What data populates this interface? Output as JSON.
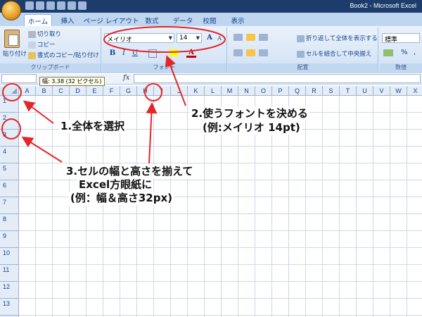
{
  "window": {
    "title": "Book2 - Microsoft Excel"
  },
  "quick_access": {
    "icons": [
      "save-icon",
      "undo-icon",
      "redo-icon",
      "cursor-icon",
      "format-icon",
      "customize-icon"
    ]
  },
  "tabs": [
    "ホーム",
    "挿入",
    "ページ レイアウト",
    "数式",
    "データ",
    "校閲",
    "表示"
  ],
  "ribbon": {
    "clipboard": {
      "paste": "貼り付け",
      "cut": "切り取り",
      "copy": "コピー",
      "format_painter": "書式のコピー/貼り付け",
      "label": "クリップボード"
    },
    "font": {
      "name": "メイリオ",
      "size": "14",
      "label": "フォント",
      "bold": "B",
      "italic": "I",
      "underline": "U",
      "color": "A"
    },
    "alignment": {
      "wrap": "折り返して全体を表示する",
      "merge": "セルを結合して中央揃え",
      "label": "配置"
    },
    "number": {
      "format": "標準",
      "percent": "%",
      "comma": ",",
      "label": "数値"
    }
  },
  "formula_bar": {
    "fx": "fx",
    "tooltip": "幅: 3.38 (32 ピクセル)"
  },
  "grid": {
    "columns": [
      "A",
      "B",
      "C",
      "D",
      "E",
      "F",
      "G",
      "H",
      "I",
      "J",
      "K",
      "L",
      "M",
      "N",
      "O",
      "P",
      "Q",
      "R",
      "S",
      "T",
      "U",
      "V",
      "W",
      "X"
    ],
    "rows": [
      "1",
      "2",
      "3",
      "4",
      "5",
      "6",
      "7",
      "8",
      "9",
      "10",
      "11",
      "12",
      "13"
    ]
  },
  "annotations": {
    "step1": "1.全体を選択",
    "step2_line1": "2.使うフォントを決める",
    "step2_line2": "(例:メイリオ 14pt)",
    "step3_line1": "3.セルの幅と高さを揃えて",
    "step3_line2": "Excel方眼紙に",
    "step3_line3": "(例：幅＆高さ32px)"
  },
  "colors": {
    "annotation": "#e3262a",
    "titlebar": "#1d3c6b",
    "ribbon": "#d1e1f4"
  }
}
